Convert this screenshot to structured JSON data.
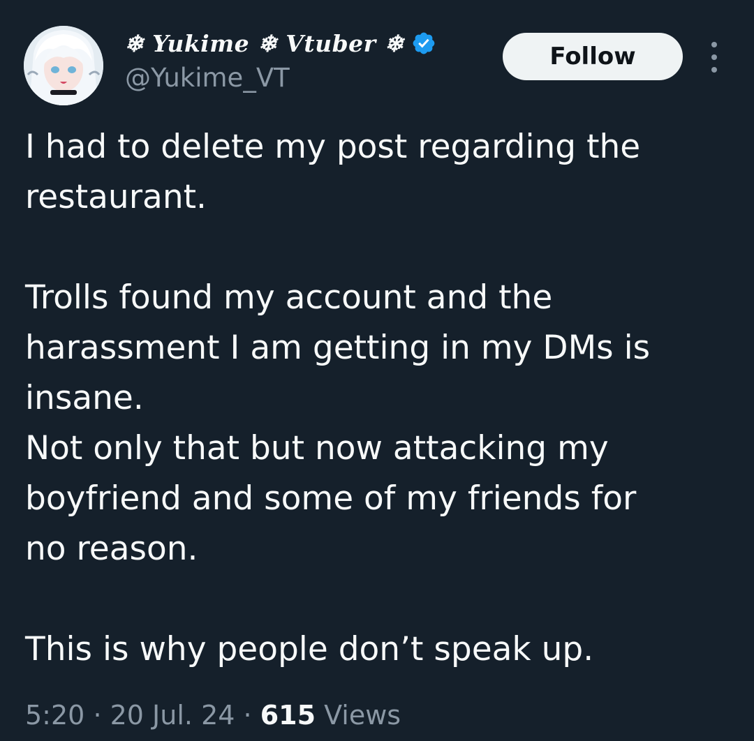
{
  "author": {
    "display_name": "❄ Yukime ❄ Vtuber ❄",
    "handle": "@Yukime_VT",
    "verified": true,
    "avatar_icon": "anime-avatar"
  },
  "actions": {
    "follow_label": "Follow",
    "more_icon": "more-vertical-icon"
  },
  "tweet": {
    "lines": [
      "I had to delete my post regarding the",
      "restaurant.",
      "",
      "Trolls found my account and the",
      "harassment I am getting in my DMs is",
      "insane.",
      "Not only that but now attacking my",
      "boyfriend and some of my friends for",
      "no reason.",
      "",
      "This is why people don’t speak up."
    ]
  },
  "meta": {
    "time": "5:20",
    "separator": "·",
    "date": "20 Jul. 24",
    "views_count": "615",
    "views_label": "Views"
  },
  "colors": {
    "background": "#15202b",
    "text_primary": "#f7f9f9",
    "text_secondary": "#8b98a5",
    "verified_blue": "#1d9bf0",
    "follow_bg": "#eff3f4"
  }
}
